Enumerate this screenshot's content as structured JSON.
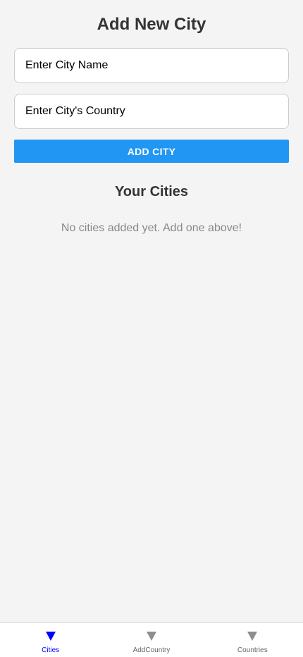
{
  "header": {
    "title": "Add New City"
  },
  "form": {
    "city_name_placeholder": "Enter City Name",
    "city_name_value": "",
    "city_country_placeholder": "Enter City's Country",
    "city_country_value": "",
    "add_button_label": "ADD CITY"
  },
  "list": {
    "title": "Your Cities",
    "empty_message": "No cities added yet. Add one above!"
  },
  "tabs": [
    {
      "label": "Cities",
      "icon": "triangle-down-icon",
      "active": true
    },
    {
      "label": "AddCountry",
      "icon": "triangle-down-icon",
      "active": false
    },
    {
      "label": "Countries",
      "icon": "triangle-down-icon",
      "active": false
    }
  ],
  "colors": {
    "accent": "#2196f3",
    "active_tab": "#0000ff",
    "inactive_tab_icon": "#8e8e8e",
    "background": "#f4f4f4"
  }
}
